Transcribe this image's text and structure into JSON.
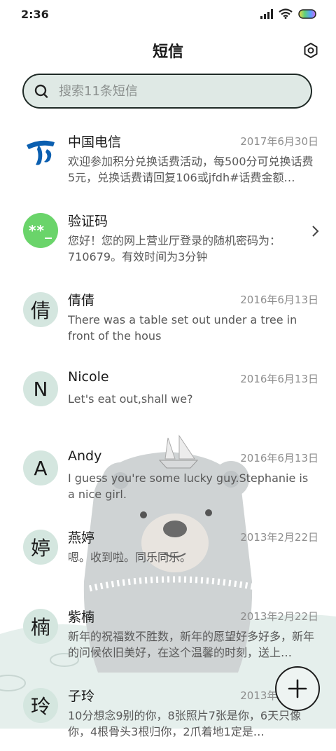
{
  "status_bar": {
    "time": "2:36"
  },
  "header": {
    "title": "短信"
  },
  "search": {
    "placeholder": "搜索11条短信"
  },
  "conversations": [
    {
      "name": "中国电信",
      "date": "2017年6月30日",
      "snippet": "欢迎参加积分兑换话费活动，每500分可兑换话费5元，兑换话费请回复106或jfdh#话费金额…",
      "avatar": "telecom-logo"
    },
    {
      "name": "验证码",
      "date": "",
      "snippet": "您好！您的网上营业厅登录的随机密码为：710679。有效时间为3分钟",
      "avatar": "**_"
    },
    {
      "name": "倩倩",
      "date": "2016年6月13日",
      "snippet": "There was a table set out under a tree in front of the hous",
      "avatar": "倩"
    },
    {
      "name": "Nicole",
      "date": "2016年6月13日",
      "snippet": "Let's eat out,shall we?",
      "avatar": "N"
    },
    {
      "name": "Andy",
      "date": "2016年6月13日",
      "snippet": "I guess you're some lucky guy.Stephanie is a nice girl.",
      "avatar": "A"
    },
    {
      "name": "燕婷",
      "date": "2013年2月22日",
      "snippet": "嗯。收到啦。同乐同乐。",
      "avatar": "婷"
    },
    {
      "name": "紫楠",
      "date": "2013年2月22日",
      "snippet": "新年的祝福数不胜数，新年的愿望好多好多，新年的问候依旧美好，在这个温馨的时刻，送上…",
      "avatar": "楠"
    },
    {
      "name": "子玲",
      "date": "2013年2月22日",
      "snippet": "10分想念9别的你，8张照片7张是你，6天只像你，4根骨头3根归你，2爪着地1定是…",
      "avatar": "玲"
    }
  ],
  "colors": {
    "accent_green": "#6ad46a",
    "avatar_bg": "#d4e6df",
    "search_bg": "#dfe9e5",
    "telecom_blue": "#0b5fb0"
  },
  "icons": {
    "settings": "gear-icon",
    "search": "search-icon",
    "compose": "plus-icon"
  }
}
